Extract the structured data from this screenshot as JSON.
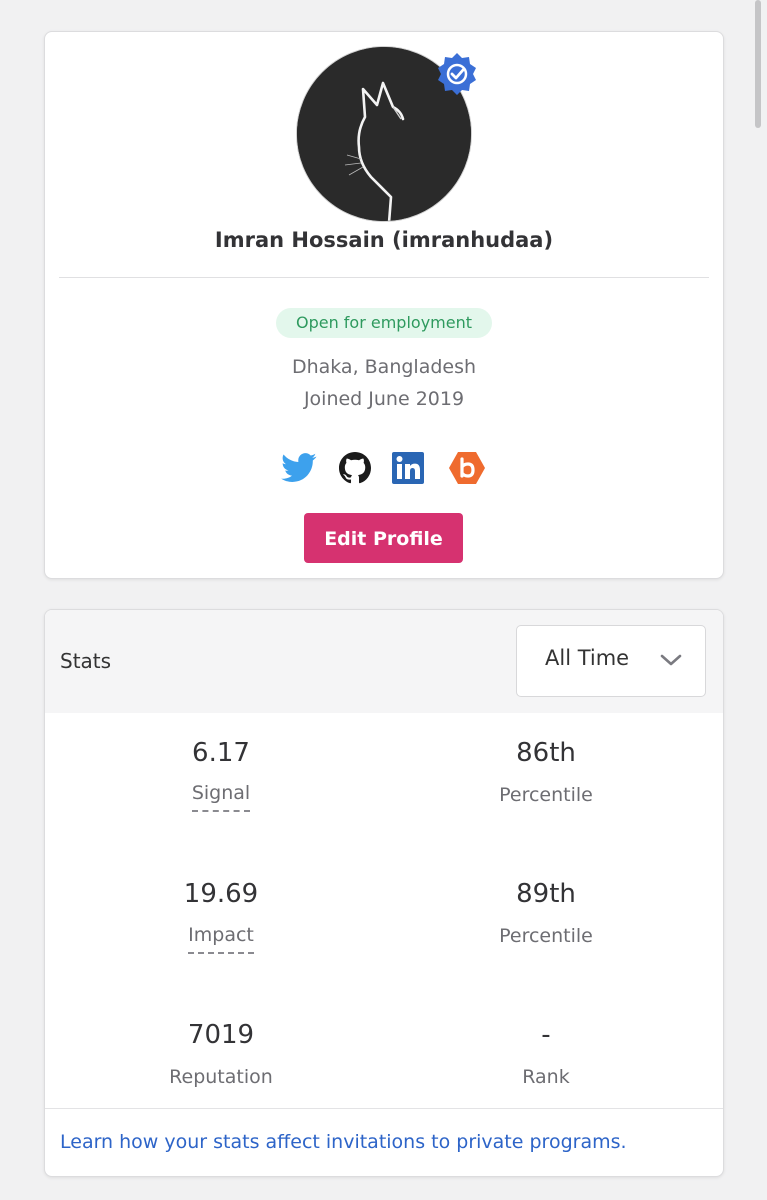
{
  "profile": {
    "name": "Imran Hossain (imranhudaa)",
    "employment_badge": "Open for employment",
    "location": "Dhaka, Bangladesh",
    "joined": "Joined June 2019",
    "socials": [
      "twitter-icon",
      "github-icon",
      "linkedin-icon",
      "bugcrowd-icon"
    ],
    "edit_button": "Edit Profile"
  },
  "stats": {
    "title": "Stats",
    "timeframe": "All Time",
    "rows": [
      {
        "value": "6.17",
        "label": "Signal",
        "percentile_value": "86th",
        "percentile_label": "Percentile"
      },
      {
        "value": "19.69",
        "label": "Impact",
        "percentile_value": "89th",
        "percentile_label": "Percentile"
      },
      {
        "value": "7019",
        "label": "Reputation",
        "percentile_value": "-",
        "percentile_label": "Rank"
      }
    ],
    "learn_link": "Learn how your stats affect invitations to private programs."
  },
  "colors": {
    "accent": "#d63270",
    "badge_bg": "#e3f7ec",
    "badge_text": "#2e9a5e",
    "link": "#2d64c8",
    "verified": "#3b6fd6"
  }
}
